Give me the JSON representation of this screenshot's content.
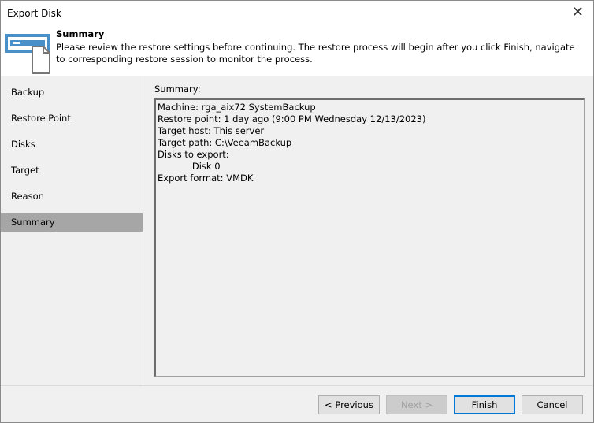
{
  "window": {
    "title": "Export Disk"
  },
  "header": {
    "title": "Summary",
    "description": "Please review the restore settings before continuing. The restore process will begin after you click Finish, navigate to corresponding restore session to monitor the process."
  },
  "nav": {
    "items": [
      {
        "label": "Backup"
      },
      {
        "label": "Restore Point"
      },
      {
        "label": "Disks"
      },
      {
        "label": "Target"
      },
      {
        "label": "Reason"
      },
      {
        "label": "Summary",
        "selected": true
      }
    ]
  },
  "summary": {
    "label": "Summary:",
    "lines": [
      "Machine: rga_aix72 SystemBackup",
      "Restore point: 1 day ago (9:00 PM Wednesday 12/13/2023)",
      "Target host: This server",
      "Target path: C:\\VeeamBackup",
      "Disks to export:",
      "            Disk 0",
      "Export format: VMDK"
    ]
  },
  "buttons": {
    "previous": "< Previous",
    "next": "Next >",
    "finish": "Finish",
    "cancel": "Cancel"
  },
  "colors": {
    "accent": "#0078d7",
    "selected": "#a6a6a6",
    "icon": "#4a90c8"
  }
}
